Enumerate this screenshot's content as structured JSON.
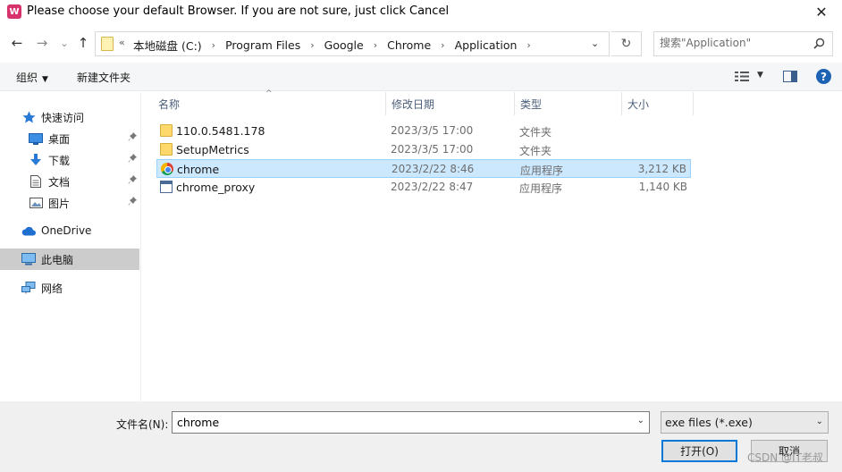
{
  "window": {
    "app_icon_glyph": "W",
    "title": "Please choose your default Browser. If you are not sure, just click Cancel",
    "close_glyph": "✕"
  },
  "nav": {
    "back_glyph": "←",
    "forward_glyph": "→",
    "recent_glyph": "⌄",
    "up_glyph": "↑",
    "refresh_glyph": "↻"
  },
  "address": {
    "overflow_glyph": "«",
    "breadcrumbs": [
      "本地磁盘 (C:)",
      "Program Files",
      "Google",
      "Chrome",
      "Application"
    ],
    "separator": "›",
    "dropdown_glyph": "⌄"
  },
  "search": {
    "placeholder": "搜索\"Application\"",
    "icon": "search-icon"
  },
  "toolbar": {
    "organize_label": "组织",
    "new_folder_label": "新建文件夹",
    "caret": "▼",
    "help_glyph": "?"
  },
  "sidebar": {
    "quick_access": "快速访问",
    "items": [
      {
        "label": "桌面",
        "icon": "desktop-icon",
        "pinned": true
      },
      {
        "label": "下载",
        "icon": "download-icon",
        "pinned": true
      },
      {
        "label": "文档",
        "icon": "document-icon",
        "pinned": true
      },
      {
        "label": "图片",
        "icon": "picture-icon",
        "pinned": true
      }
    ],
    "onedrive": "OneDrive",
    "this_pc": "此电脑",
    "network": "网络",
    "pin_glyph": "📌"
  },
  "columns": {
    "name": "名称",
    "date": "修改日期",
    "type": "类型",
    "size": "大小",
    "sort_glyph": "^"
  },
  "files": [
    {
      "name": "110.0.5481.178",
      "date": "2023/3/5 17:00",
      "type": "文件夹",
      "size": "",
      "icon": "folder-icon"
    },
    {
      "name": "SetupMetrics",
      "date": "2023/3/5 17:00",
      "type": "文件夹",
      "size": "",
      "icon": "folder-icon"
    },
    {
      "name": "chrome",
      "date": "2023/2/22 8:46",
      "type": "应用程序",
      "size": "3,212 KB",
      "icon": "chrome-icon",
      "selected": true
    },
    {
      "name": "chrome_proxy",
      "date": "2023/2/22 8:47",
      "type": "应用程序",
      "size": "1,140 KB",
      "icon": "exe-icon"
    }
  ],
  "footer": {
    "filename_label": "文件名(N):",
    "filename_value": "chrome",
    "filetype_value": "exe files (*.exe)",
    "open_label": "打开(O)",
    "cancel_label": "取消",
    "dropdown_glyph": "⌄"
  },
  "watermark": "CSDN @IT老叔",
  "colors": {
    "selection_bg": "#cce8ff",
    "selection_border": "#99d1ff",
    "accent": "#0078d7"
  }
}
